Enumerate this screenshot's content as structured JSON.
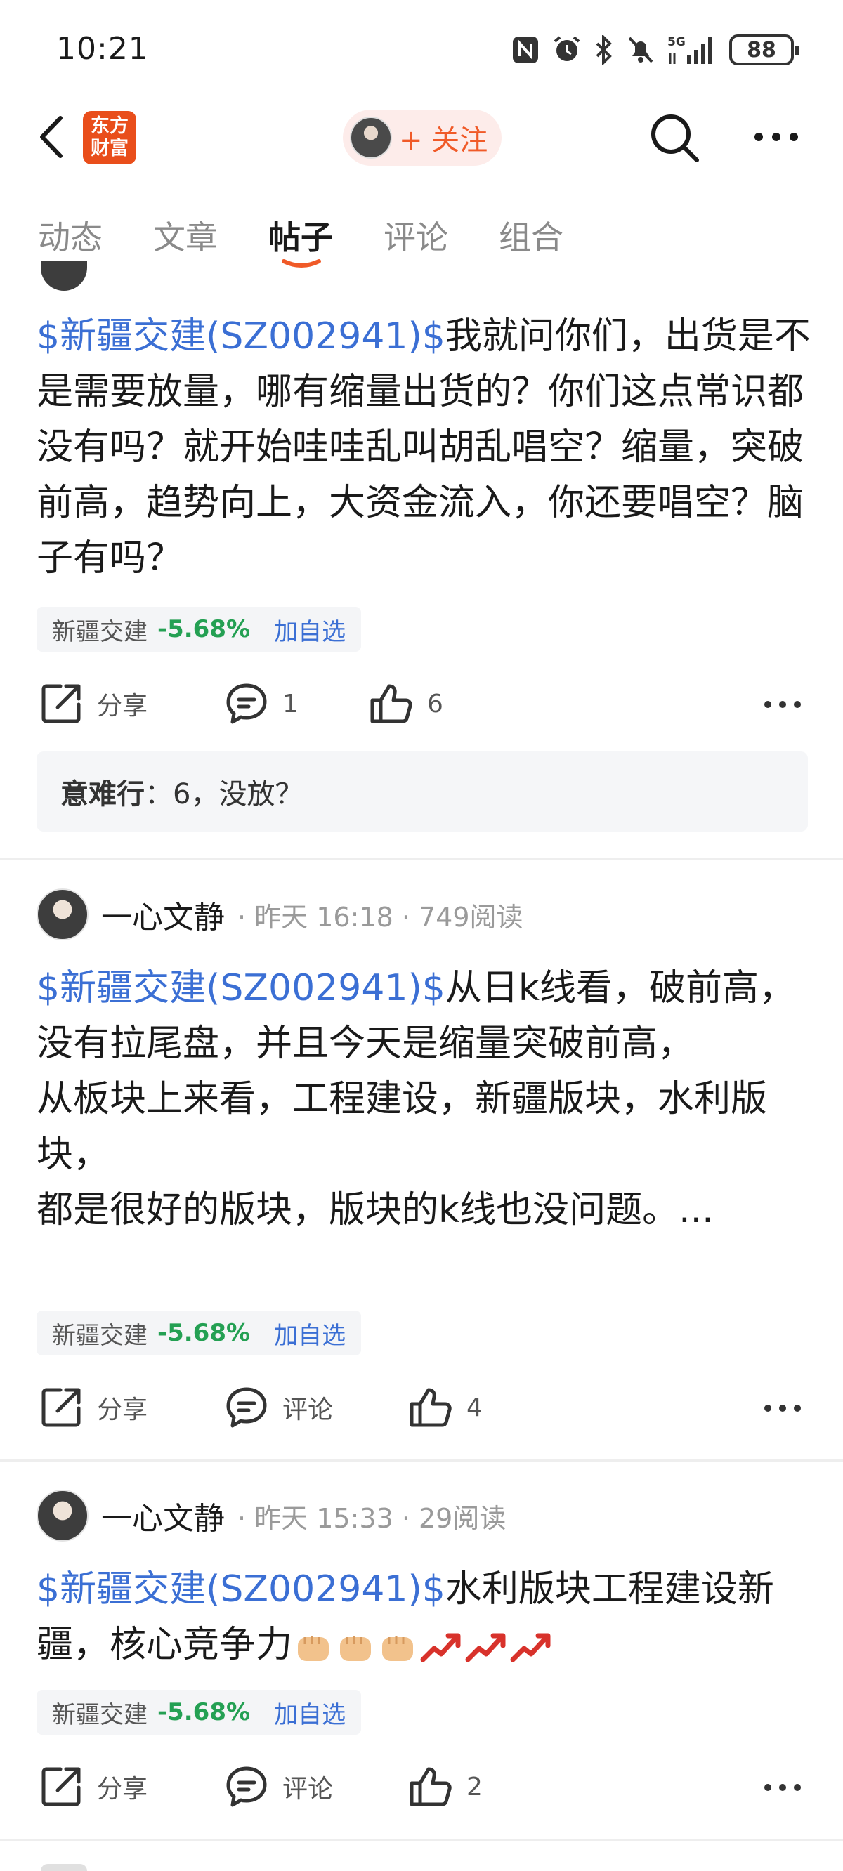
{
  "status_bar": {
    "time": "10:21",
    "battery": "88",
    "network": "5G",
    "icons": [
      "nfc-icon",
      "alarm-icon",
      "bluetooth-icon",
      "mute-icon",
      "signal-icon",
      "battery-icon"
    ]
  },
  "header": {
    "logo_line1": "东方",
    "logo_line2": "财富",
    "follow_label": "+ 关注",
    "accent_color": "#f05a28"
  },
  "tabs": [
    {
      "label": "动态"
    },
    {
      "label": "文章"
    },
    {
      "label": "帖子",
      "active": true
    },
    {
      "label": "评论"
    },
    {
      "label": "组合"
    }
  ],
  "colors": {
    "stock_link": "#3b6fd4",
    "stock_down": "#24a053",
    "logo": "#e94e1b"
  },
  "posts": [
    {
      "stock_link": "$新疆交建(SZ002941)$",
      "text": "我就问你们，出货是不是需要放量，哪有缩量出货的？你们这点常识都没有吗？就开始哇哇乱叫胡乱唱空？缩量，突破前高，趋势向上，大资金流入，你还要唱空？脑子有吗？",
      "tag": {
        "name": "新疆交建",
        "pct": "-5.68%",
        "add": "加自选"
      },
      "actions": {
        "share": "分享",
        "comment": "1",
        "like": "6"
      },
      "top_comment": {
        "author": "意难行",
        "sep": "：",
        "text": "6，没放？"
      }
    },
    {
      "author": "一心文静",
      "meta": "· 昨天 16:18 · 749阅读",
      "stock_link": "$新疆交建(SZ002941)$",
      "line1": "从日k线看，破前高，没有拉尾盘，并且今天是缩量突破前高，",
      "line2": "从板块上来看，工程建设，新疆版块，水利版块，",
      "line3": "都是很好的版块，版块的k线也没问题。...",
      "tag": {
        "name": "新疆交建",
        "pct": "-5.68%",
        "add": "加自选"
      },
      "actions": {
        "share": "分享",
        "comment": "评论",
        "like": "4"
      }
    },
    {
      "author": "一心文静",
      "meta": "· 昨天 15:33 · 29阅读",
      "stock_link": "$新疆交建(SZ002941)$",
      "text": "水利版块工程建设新疆，核心竞争力",
      "emojis": [
        "fist-emoji",
        "fist-emoji",
        "fist-emoji",
        "trend-up-emoji",
        "trend-up-emoji",
        "trend-up-emoji"
      ],
      "tag": {
        "name": "新疆交建",
        "pct": "-5.68%",
        "add": "加自选"
      },
      "actions": {
        "share": "分享",
        "comment": "评论",
        "like": "2"
      }
    }
  ]
}
